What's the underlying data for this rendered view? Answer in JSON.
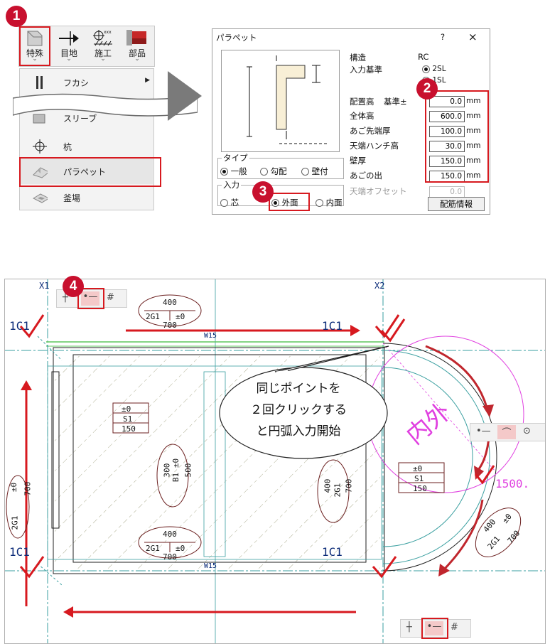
{
  "toolbar": {
    "buttons": [
      {
        "label": "特殊"
      },
      {
        "label": "目地"
      },
      {
        "label": "施工"
      },
      {
        "label": "部品"
      }
    ]
  },
  "menu": {
    "items": [
      {
        "label": "フカシ"
      },
      {
        "label": "スリーブ"
      },
      {
        "label": "杭"
      },
      {
        "label": "パラペット"
      },
      {
        "label": "釜場"
      }
    ]
  },
  "steps": [
    "1",
    "2",
    "3",
    "4"
  ],
  "dialog": {
    "title": "パラペット",
    "help": "?",
    "close": "×",
    "kozo_label": "構造",
    "kozo_value": "RC",
    "kijun_label": "入力基準",
    "kijun_options": [
      "2SL",
      "1SL"
    ],
    "haichi_label": "配置高",
    "haichi_sub": "基準±",
    "fields": [
      {
        "label": "全体高",
        "value": "600.0"
      },
      {
        "label": "あご先端厚",
        "value": "100.0"
      },
      {
        "label": "天端ハンチ高",
        "value": "30.0"
      },
      {
        "label": "壁厚",
        "value": "150.0"
      },
      {
        "label": "あごの出",
        "value": "150.0"
      }
    ],
    "haichi_value": "0.0",
    "unit": "mm",
    "tenba_offset_label": "天端オフセット",
    "tenba_offset_value": "0.0",
    "type_group_label": "タイプ",
    "type_options": [
      "一般",
      "勾配",
      "壁付"
    ],
    "input_group_label": "入力",
    "input_options": [
      "芯",
      "外面",
      "内面"
    ],
    "rebar_button": "配筋情報"
  },
  "cad": {
    "grid_labels": [
      "X1",
      "X2"
    ],
    "column_labels": [
      "1C1",
      "1C1",
      "1C1",
      "1C1"
    ],
    "wall_label": "W15",
    "beam_tag_top": {
      "top": "400",
      "left": "2G1",
      "right": "±0",
      "bottom": "700"
    },
    "beam_tag_bottom": {
      "top": "400",
      "left": "2G1",
      "right": "±0",
      "bottom": "700"
    },
    "slab_tag_left": [
      "±0",
      "S1",
      "150"
    ],
    "slab_tag_right": [
      "±0",
      "S1",
      "150"
    ],
    "b1_tag": [
      "300",
      "B1",
      "±0",
      "500"
    ],
    "g_tag_right": [
      "400",
      "2G1",
      "700"
    ],
    "g_tag_left": [
      "±0",
      "700",
      "2G1"
    ],
    "arc_tag": [
      "400",
      "±0",
      "2G1",
      "700"
    ],
    "inner_outer": "内外",
    "dimension": "1500.",
    "callout_lines": [
      "同じポイントを",
      "２回クリックする",
      "と円弧入力開始"
    ]
  },
  "colors": {
    "accent_red": "#d7191f",
    "step_red": "#c8102e",
    "cad_cyan": "#3a9fa0",
    "cad_brown": "#6b1f1f",
    "cad_magenta": "#e040e0"
  }
}
